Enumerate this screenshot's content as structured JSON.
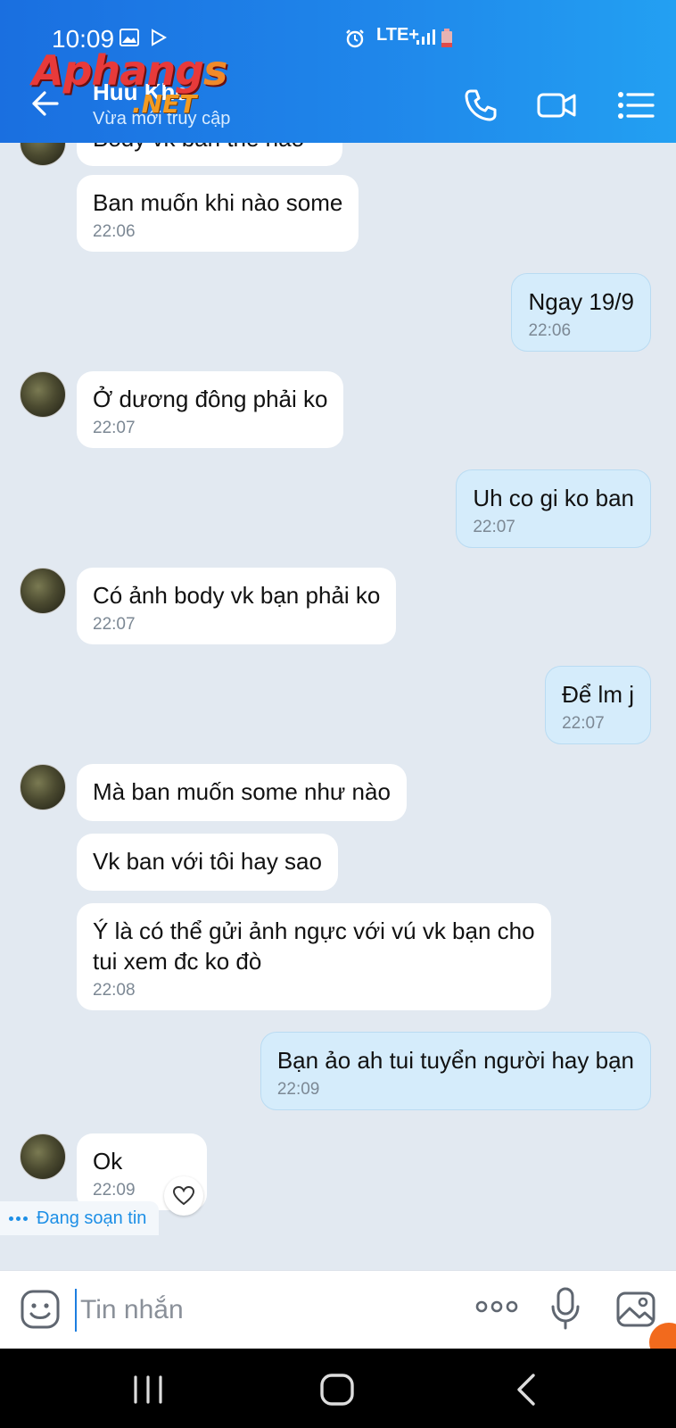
{
  "status_bar": {
    "time": "10:09",
    "network": "LTE+"
  },
  "header": {
    "contact_name": "Huu Khc",
    "presence": "Vừa mới truy cập"
  },
  "watermark": {
    "line1a": "Aphang",
    "line1b": "s",
    "line2": ".NET"
  },
  "messages": [
    {
      "side": "in",
      "text": "Body vk ban the nao",
      "time": ""
    },
    {
      "side": "in",
      "text": "Ban muốn khi nào some",
      "time": "22:06"
    },
    {
      "side": "out",
      "text": "Ngay 19/9",
      "time": "22:06"
    },
    {
      "side": "in",
      "text": "Ở dương đông phải ko",
      "time": "22:07"
    },
    {
      "side": "out",
      "text": "Uh co gi ko ban",
      "time": "22:07"
    },
    {
      "side": "in",
      "text": "Có ảnh body vk bạn phải ko",
      "time": "22:07"
    },
    {
      "side": "out",
      "text": "Để lm j",
      "time": "22:07"
    },
    {
      "side": "in",
      "text": "Mà ban muốn some như nào",
      "time": ""
    },
    {
      "side": "in",
      "text": "Vk ban với tôi hay sao",
      "time": ""
    },
    {
      "side": "in",
      "text": "Ý là có thể gửi ảnh ngực với vú vk bạn cho tui xem đc ko đò",
      "time": "22:08"
    },
    {
      "side": "out",
      "text": "Bạn ảo ah tui tuyển người hay bạn",
      "time": "22:09"
    },
    {
      "side": "in",
      "text": "Ok",
      "time": "22:09"
    }
  ],
  "typing_indicator": "Đang soạn tin",
  "composer": {
    "placeholder": "Tin nhắn"
  },
  "icons": {
    "back": "arrow-left",
    "call": "phone",
    "video": "video-camera",
    "menu": "list",
    "sticker": "emoji",
    "more": "ellipsis",
    "voice": "microphone",
    "image": "gallery",
    "reaction": "heart"
  },
  "colors": {
    "header_start": "#1a6fe0",
    "header_end": "#23a0f2",
    "chat_bg": "#e2e9f1",
    "outgoing": "#d5ecfb",
    "incoming": "#ffffff"
  }
}
